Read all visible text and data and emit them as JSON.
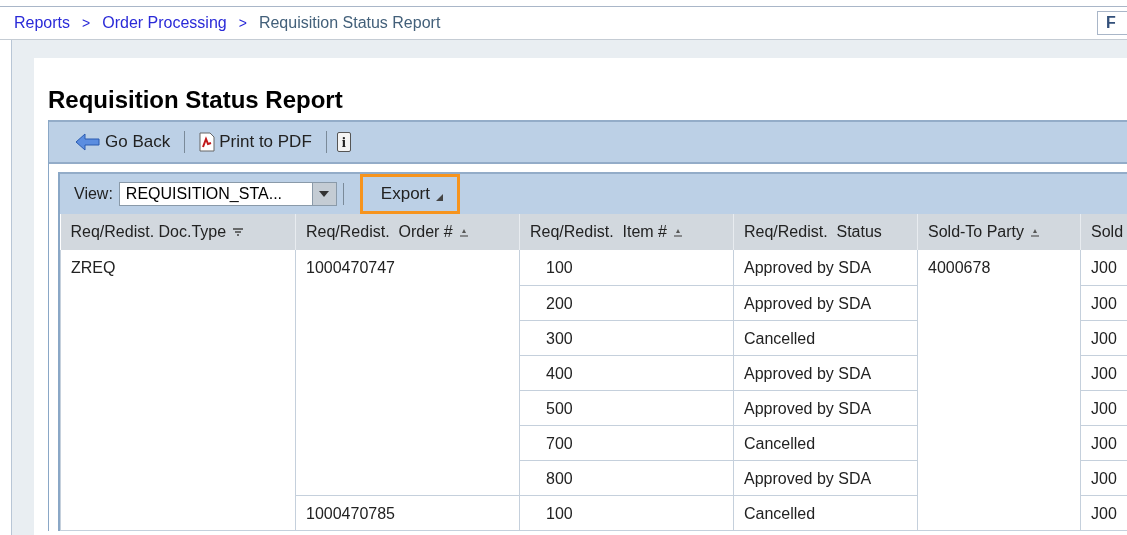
{
  "breadcrumbs": [
    {
      "label": "Reports",
      "link": true
    },
    {
      "label": "Order Processing",
      "link": true
    },
    {
      "label": "Requisition Status Report",
      "link": false
    }
  ],
  "breadcrumb_separator": ">",
  "top_right_button": "F",
  "title": "Requisition Status Report",
  "toolbar": [
    {
      "kind": "back",
      "label": "Go Back"
    },
    {
      "kind": "pdf",
      "label": "Print to PDF"
    },
    {
      "kind": "info",
      "label": "i"
    }
  ],
  "view": {
    "label": "View:",
    "value": "REQUISITION_STA..."
  },
  "export": {
    "label": "Export",
    "highlighted": true
  },
  "table": {
    "columns": [
      {
        "label": "Req/Redist. Doc.Type",
        "kind": "filter"
      },
      {
        "label": "Req/Redist.  Order #",
        "kind": "sort"
      },
      {
        "label": "Req/Redist.  Item #",
        "kind": "sort"
      },
      {
        "label": "Req/Redist.  Status",
        "kind": "plain"
      },
      {
        "label": "Sold-To Party",
        "kind": "sort"
      },
      {
        "label": "Sold",
        "kind": "plain"
      }
    ],
    "rows": [
      {
        "cells": [
          {
            "text": "ZREQ",
            "rowspan": 8
          },
          {
            "text": "1000470747",
            "rowspan": 7
          },
          {
            "text": "100"
          },
          {
            "text": "Approved by SDA"
          },
          {
            "text": "4000678",
            "rowspan": 8
          },
          {
            "text": "J00"
          }
        ]
      },
      {
        "cells": [
          {
            "text": "200"
          },
          {
            "text": "Approved by SDA"
          },
          {
            "text": "J00"
          }
        ]
      },
      {
        "cells": [
          {
            "text": "300"
          },
          {
            "text": "Cancelled"
          },
          {
            "text": "J00"
          }
        ]
      },
      {
        "cells": [
          {
            "text": "400"
          },
          {
            "text": "Approved by SDA"
          },
          {
            "text": "J00"
          }
        ]
      },
      {
        "cells": [
          {
            "text": "500"
          },
          {
            "text": "Approved by SDA"
          },
          {
            "text": "J00"
          }
        ]
      },
      {
        "cells": [
          {
            "text": "700"
          },
          {
            "text": "Cancelled"
          },
          {
            "text": "J00"
          }
        ]
      },
      {
        "cells": [
          {
            "text": "800"
          },
          {
            "text": "Approved by SDA"
          },
          {
            "text": "J00"
          }
        ]
      },
      {
        "cells": [
          {
            "text": "1000470785"
          },
          {
            "text": "100"
          },
          {
            "text": "Cancelled"
          },
          {
            "text": "J00"
          }
        ]
      }
    ]
  }
}
